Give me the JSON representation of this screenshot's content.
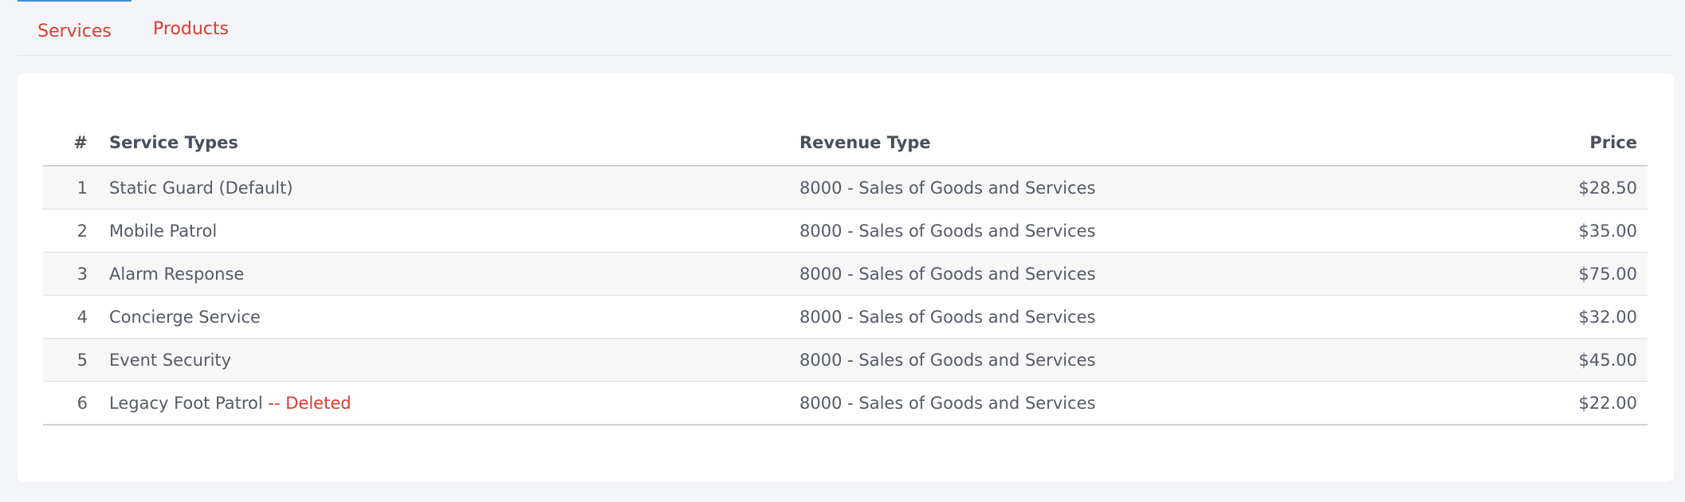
{
  "tabs": [
    {
      "label": "Services",
      "active": true
    },
    {
      "label": "Products",
      "active": false
    }
  ],
  "table": {
    "headers": {
      "num": "#",
      "service_types": "Service Types",
      "revenue_type": "Revenue Type",
      "price": "Price"
    },
    "rows": [
      {
        "num": "1",
        "name": "Static Guard (Default)",
        "suffix": "",
        "revenue": "8000 - Sales of Goods and Services",
        "price": "$28.50"
      },
      {
        "num": "2",
        "name": "Mobile Patrol",
        "suffix": "",
        "revenue": "8000 - Sales of Goods and Services",
        "price": "$35.00"
      },
      {
        "num": "3",
        "name": "Alarm Response",
        "suffix": "",
        "revenue": "8000 - Sales of Goods and Services",
        "price": "$75.00"
      },
      {
        "num": "4",
        "name": "Concierge Service",
        "suffix": "",
        "revenue": "8000 - Sales of Goods and Services",
        "price": "$32.00"
      },
      {
        "num": "5",
        "name": "Event Security",
        "suffix": "",
        "revenue": "8000 - Sales of Goods and Services",
        "price": "$45.00"
      },
      {
        "num": "6",
        "name": "Legacy Foot Patrol",
        "suffix": "-- Deleted",
        "revenue": "8000 - Sales of Goods and Services",
        "price": "$22.00"
      }
    ]
  },
  "colors": {
    "tab_text": "#e0392f",
    "tab_active_border": "#3f8fd2",
    "deleted_text": "#e0392f",
    "page_background": "#f4f5f8",
    "card_background": "#ffffff"
  }
}
